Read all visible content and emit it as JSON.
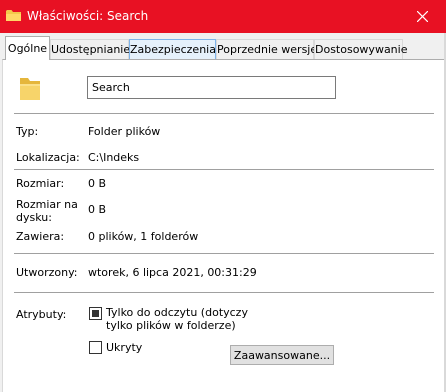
{
  "window": {
    "title": "Właściwości: Search",
    "accent_color": "#e81123",
    "icons": {
      "title": "folder-icon",
      "close": "close-icon",
      "main": "folder-icon"
    }
  },
  "tabs": [
    {
      "label": "Ogólne",
      "active": true
    },
    {
      "label": "Udostępnianie",
      "active": false
    },
    {
      "label": "Zabezpieczenia",
      "active": false,
      "hover": true
    },
    {
      "label": "Poprzednie wersje",
      "active": false
    },
    {
      "label": "Dostosowywanie",
      "active": false
    }
  ],
  "general": {
    "name_value": "Search",
    "type_label": "Typ:",
    "type_value": "Folder plików",
    "location_label": "Lokalizacja:",
    "location_value": "C:\\Indeks",
    "size_label": "Rozmiar:",
    "size_value": "0 B",
    "size_on_disk_label_line1": "Rozmiar na",
    "size_on_disk_label_line2": "dysku:",
    "size_on_disk_value": "0 B",
    "contains_label": "Zawiera:",
    "contains_value": "0 plików, 1 folderów",
    "created_label": "Utworzony:",
    "created_value": "wtorek, 6 lipca 2021, 00:31:29",
    "attributes_label": "Atrybuty:",
    "readonly_label_line1": "Tylko do odczytu (dotyczy",
    "readonly_label_line2": "tylko plików w folderze)",
    "readonly_state": "indeterminate",
    "hidden_label": "Ukryty",
    "hidden_checked": false,
    "advanced_button": "Zaawansowane..."
  }
}
